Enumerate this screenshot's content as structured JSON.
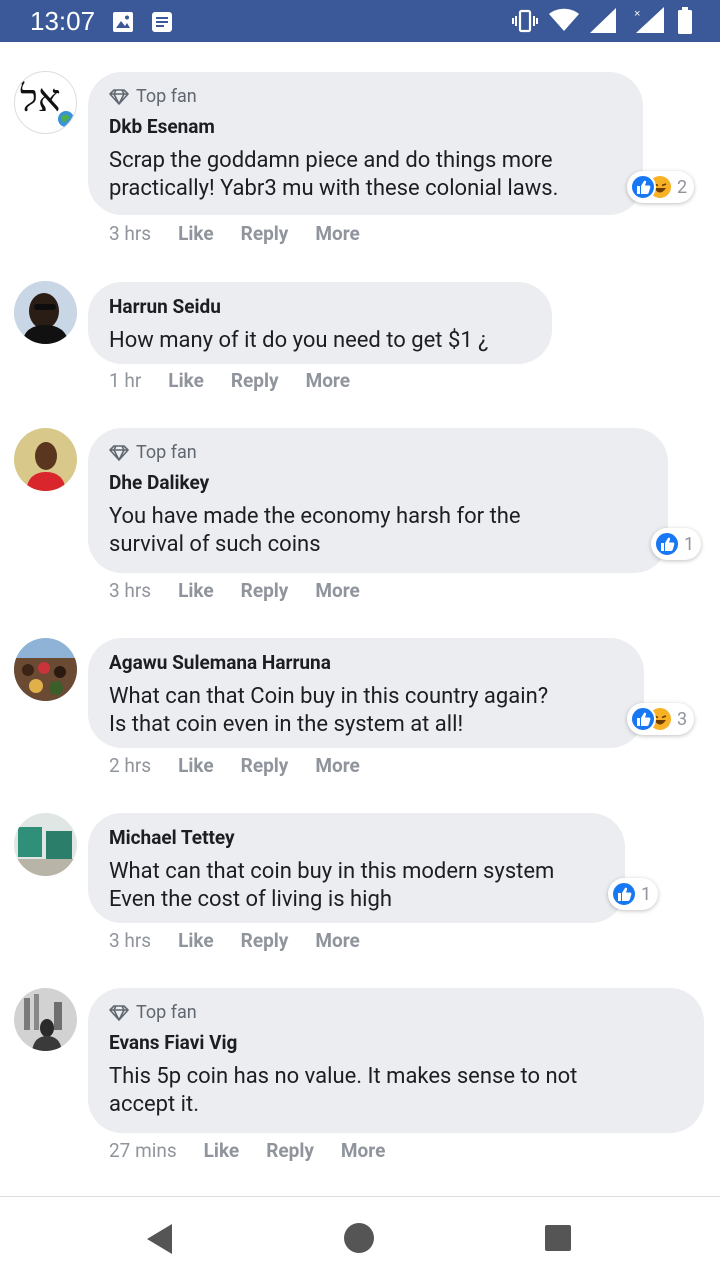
{
  "status_bar": {
    "time": "13:07",
    "bg_color": "#3b5998"
  },
  "comments": [
    {
      "top_fan_label": "Top fan",
      "author": "Dkb Esenam",
      "text": "Scrap the goddamn piece and do things more\npractically! Yabr3 mu with these colonial laws.",
      "time": "3 hrs",
      "like": "Like",
      "reply": "Reply",
      "more": "More",
      "reactions": [
        "like",
        "haha"
      ],
      "reaction_count": "2"
    },
    {
      "author": "Harrun Seidu",
      "text": "How many of it do you need to get $1 ¿",
      "time": "1 hr",
      "like": "Like",
      "reply": "Reply",
      "more": "More"
    },
    {
      "top_fan_label": "Top fan",
      "author": "Dhe Dalikey",
      "text": "You have made the economy harsh for the\nsurvival of such coins",
      "time": "3 hrs",
      "like": "Like",
      "reply": "Reply",
      "more": "More",
      "reactions": [
        "like"
      ],
      "reaction_count": "1"
    },
    {
      "author": "Agawu Sulemana Harruna",
      "text": "What can that Coin buy in this country again?\nIs that coin even in the system at all!",
      "time": "2 hrs",
      "like": "Like",
      "reply": "Reply",
      "more": "More",
      "reactions": [
        "like",
        "haha"
      ],
      "reaction_count": "3"
    },
    {
      "author": "Michael Tettey",
      "text": "What can that coin buy in this modern system\nEven the cost of living is high",
      "time": "3 hrs",
      "like": "Like",
      "reply": "Reply",
      "more": "More",
      "reactions": [
        "like"
      ],
      "reaction_count": "1"
    },
    {
      "top_fan_label": "Top fan",
      "author": "Evans Fiavi Vig",
      "text": "This 5p coin has no value. It makes sense to not\naccept it.",
      "time": "27 mins",
      "like": "Like",
      "reply": "Reply",
      "more": "More"
    }
  ],
  "avatars": {
    "c0_text": "אל"
  }
}
